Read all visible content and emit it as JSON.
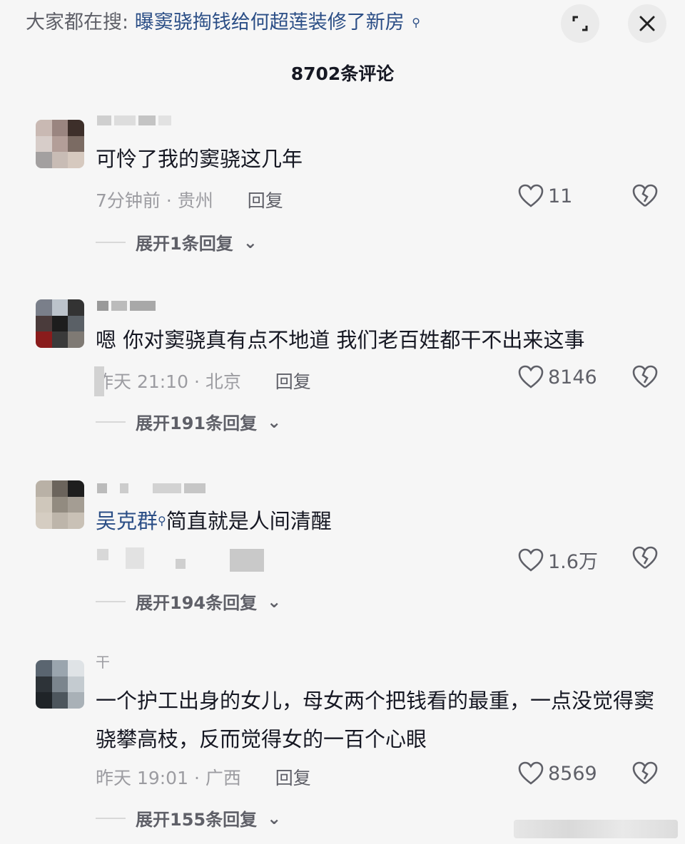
{
  "topbar": {
    "search_prefix": "大家都在搜:",
    "search_query": "曝窦骁掏钱给何超莲装修了新房",
    "expand_icon": "expand-icon",
    "close_icon": "close-icon"
  },
  "header": {
    "comment_count": "8702条评论"
  },
  "comments": [
    {
      "text": "可怜了我的窦骁这几年",
      "time_location": "7分钟前 · 贵州",
      "reply_label": "回复",
      "likes": "11",
      "expand_label": "展开1条回复"
    },
    {
      "text": "嗯 你对窦骁真有点不地道 我们老百姓都干不出来这事",
      "time_location": "昨天 21:10 · 北京",
      "reply_label": "回复",
      "likes": "8146",
      "expand_label": "展开191条回复"
    },
    {
      "mention": "吴克群",
      "text": "简直就是人间清醒",
      "likes": "1.6万",
      "expand_label": "展开194条回复"
    },
    {
      "username": "干",
      "text": "一个护工出身的女儿，母女两个把钱看的最重，一点没觉得窦骁攀高枝，反而觉得女的一百个心眼",
      "time_location": "昨天 19:01 · 广西",
      "reply_label": "回复",
      "likes": "8569",
      "expand_label": "展开155条回复"
    }
  ],
  "colors": {
    "background": "#f6f6f6",
    "link_blue": "#2b4e86",
    "meta_gray": "#9c9ca1"
  }
}
